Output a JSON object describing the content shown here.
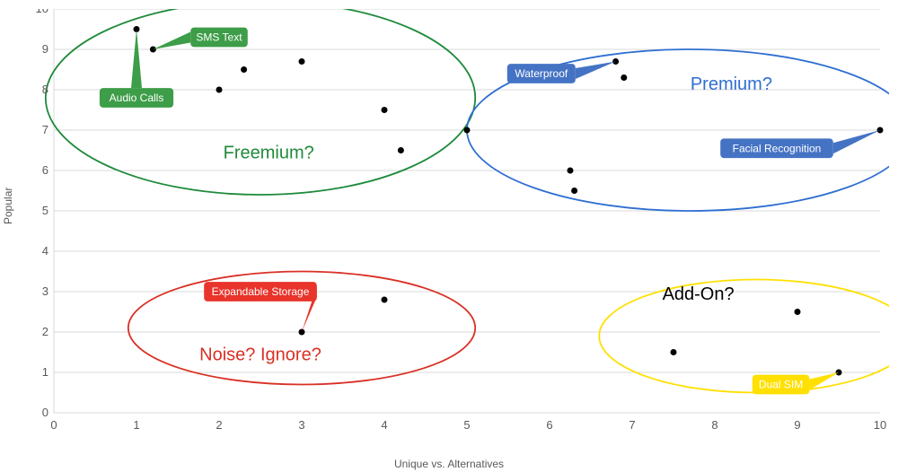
{
  "chart_data": {
    "type": "scatter",
    "title": "",
    "xlabel": "Unique vs. Alternatives",
    "ylabel": "Popular",
    "xlim": [
      0,
      10
    ],
    "ylim": [
      0,
      10
    ],
    "xticks": [
      0,
      1,
      2,
      3,
      4,
      5,
      6,
      7,
      8,
      9,
      10
    ],
    "yticks": [
      0,
      1,
      2,
      3,
      4,
      5,
      6,
      7,
      8,
      9,
      10
    ],
    "points": [
      {
        "x": 1.0,
        "y": 9.5,
        "label": "Audio Calls"
      },
      {
        "x": 1.2,
        "y": 9.0,
        "label": "SMS Text"
      },
      {
        "x": 2.0,
        "y": 8.0
      },
      {
        "x": 2.3,
        "y": 8.5
      },
      {
        "x": 3.0,
        "y": 8.7
      },
      {
        "x": 4.0,
        "y": 7.5
      },
      {
        "x": 4.2,
        "y": 6.5
      },
      {
        "x": 5.0,
        "y": 7.0
      },
      {
        "x": 6.25,
        "y": 6.0
      },
      {
        "x": 6.3,
        "y": 5.5
      },
      {
        "x": 6.8,
        "y": 8.7,
        "label": "Waterproof"
      },
      {
        "x": 6.9,
        "y": 8.3
      },
      {
        "x": 10.0,
        "y": 7.0,
        "label": "Facial Recognition"
      },
      {
        "x": 3.0,
        "y": 2.0,
        "label": "Expandable Storage"
      },
      {
        "x": 4.0,
        "y": 2.8
      },
      {
        "x": 7.5,
        "y": 1.5
      },
      {
        "x": 9.0,
        "y": 2.5
      },
      {
        "x": 9.5,
        "y": 1.0,
        "label": "Dual SIM"
      }
    ],
    "regions": [
      {
        "name": "Freemium?",
        "color": "#1f8a3b",
        "cx": 2.5,
        "cy": 7.8,
        "rx": 2.6,
        "ry": 2.4,
        "label_xy": [
          2.6,
          6.3
        ]
      },
      {
        "name": "Premium?",
        "color": "#2f6fd1",
        "cx": 7.7,
        "cy": 7.0,
        "rx": 2.7,
        "ry": 2.0,
        "label_xy": [
          8.2,
          8.0
        ]
      },
      {
        "name": "Noise? Ignore?",
        "color": "#d93025",
        "cx": 3.0,
        "cy": 2.1,
        "rx": 2.1,
        "ry": 1.4,
        "label_xy": [
          2.5,
          1.3
        ]
      },
      {
        "name": "Add-On?",
        "color": "#ffe000",
        "cx": 8.5,
        "cy": 1.9,
        "rx": 1.9,
        "ry": 1.4,
        "label_xy": [
          7.8,
          2.8
        ]
      }
    ],
    "callouts": [
      {
        "text": "SMS Text",
        "fill": "#3d9d48",
        "box_xy": [
          2.0,
          9.3
        ],
        "tip_xy": [
          1.2,
          9.0
        ]
      },
      {
        "text": "Audio Calls",
        "fill": "#3d9d48",
        "box_xy": [
          1.0,
          7.8
        ],
        "tip_xy": [
          1.0,
          9.5
        ]
      },
      {
        "text": "Waterproof",
        "fill": "#4573c4",
        "box_xy": [
          5.9,
          8.4
        ],
        "tip_xy": [
          6.8,
          8.7
        ]
      },
      {
        "text": "Facial Recognition",
        "fill": "#4573c4",
        "box_xy": [
          8.75,
          6.55
        ],
        "tip_xy": [
          10.0,
          7.0
        ]
      },
      {
        "text": "Expandable Storage",
        "fill": "#e8342b",
        "box_xy": [
          2.5,
          3.0
        ],
        "tip_xy": [
          3.0,
          2.0
        ]
      },
      {
        "text": "Dual SIM",
        "fill": "#ffe000",
        "box_xy": [
          8.8,
          0.7
        ],
        "tip_xy": [
          9.5,
          1.0
        ],
        "textfill": "#000"
      }
    ]
  }
}
